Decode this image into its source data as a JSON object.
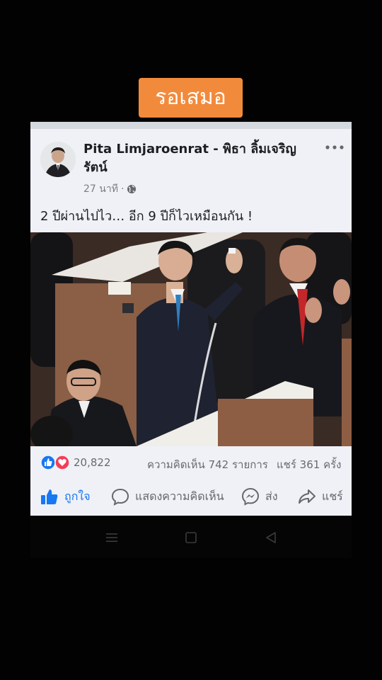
{
  "banner": {
    "text": "รอเสมอ",
    "bg_color": "#f28a3c"
  },
  "post": {
    "author": "Pita Limjaroenrat - พิธา ลิ้มเจริญรัตน์",
    "time": "27 นาที",
    "audience_icon": "globe-icon",
    "text": "2 ปีผ่านไปไว… อีก 9 ปีก็ไวเหมือนกัน !",
    "menu_icon": "more-dots-icon"
  },
  "stats": {
    "reaction_icons": [
      "like-reaction-icon",
      "love-reaction-icon"
    ],
    "reactions": "20,822",
    "comments": "ความคิดเห็น 742 รายการ",
    "shares": "แชร์ 361 ครั้ง"
  },
  "actions": {
    "like": "ถูกใจ",
    "comment": "แสดงความคิดเห็น",
    "send": "ส่ง",
    "share": "แชร์"
  },
  "colors": {
    "like_blue": "#1877f2",
    "love_red": "#f33e58"
  },
  "navbar": {
    "icons": [
      "menu-icon",
      "home-square-icon",
      "back-triangle-icon"
    ]
  }
}
